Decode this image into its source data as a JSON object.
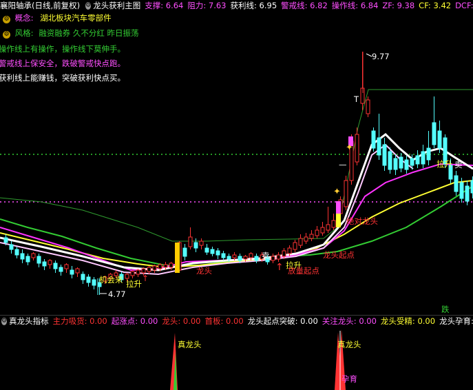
{
  "header": {
    "stock_title": "襄阳轴承(日线,前复权)",
    "indicator_name": "龙头获利主图",
    "fields": [
      {
        "label": "支撑: ",
        "value": "6.64",
        "color": "#ff4fff"
      },
      {
        "label": "阻力: ",
        "value": "7.63",
        "color": "#ff4fff"
      },
      {
        "label": "获利线: ",
        "value": "6.95",
        "color": "#ffffff"
      },
      {
        "label": "警戒线: ",
        "value": "6.82",
        "color": "#ff4fff"
      },
      {
        "label": "操作线: ",
        "value": "6.84",
        "color": "#ff4fff"
      },
      {
        "label": "ZF: ",
        "value": "9.38",
        "color": "#ff4fff"
      },
      {
        "label": "CF: ",
        "value": "3.42",
        "color": "#ffff33"
      },
      {
        "label": "DCF: ",
        "value": "-",
        "color": "#ff4fff"
      }
    ]
  },
  "notes": {
    "concept_label": "概念:",
    "concept_value": "湖北板块汽车零部件",
    "style_label": "风格:",
    "style_value": "融资融券 久不分红 昨日振荡",
    "line1": "操作线上有操作，操作线下莫伸手。",
    "line2": "警戒线上保安全，跌破警戒快点跑。",
    "line3": "获利线上能赚钱，突破获利快点买。"
  },
  "price_labels": {
    "high": "9.77",
    "low": "4.77"
  },
  "chart_annotations": {
    "t_mark": "T",
    "opportunity": "机会来",
    "pullup_left": "拉升",
    "pullup_right": "拉升",
    "pullup_mid": "拉升",
    "sell_mid": "卖",
    "sell_right": "卖",
    "dragon_left": "龙头",
    "dragon_start": "龙头起点",
    "start_point": "放量起点",
    "absolute_dragon": "绝对龙头",
    "drop": "跌"
  },
  "sub_header": {
    "indicator_name": "真龙头指标",
    "fields": [
      {
        "label": "主力吸货: ",
        "value": "0.00",
        "color": "#ff3333"
      },
      {
        "label": "起涨点: ",
        "value": "0.00",
        "color": "#ff4fff"
      },
      {
        "label": "龙头: ",
        "value": "0.00",
        "color": "#ff3333"
      },
      {
        "label": "首板: ",
        "value": "0.00",
        "color": "#ff3333"
      },
      {
        "label": "龙头起点突破: ",
        "value": "0.00",
        "color": "#ffffff"
      },
      {
        "label": "关注龙头: ",
        "value": "0.00",
        "color": "#ff4fff"
      },
      {
        "label": "龙头受精: ",
        "value": "0.00",
        "color": "#ffff33"
      },
      {
        "label": "龙头孕育: ",
        "value": "",
        "color": "#ffffff"
      }
    ]
  },
  "sub_annotations": {
    "true_dragon_left": "真龙头",
    "true_dragon_right": "真龙头",
    "nurture": "孕育"
  },
  "colors": {
    "up": "#ff3333",
    "down": "#54ffff",
    "support_line": "#ff4fff",
    "resist_line": "#33cc33",
    "yellow_line": "#ffff33",
    "green_line": "#33cc33"
  }
}
